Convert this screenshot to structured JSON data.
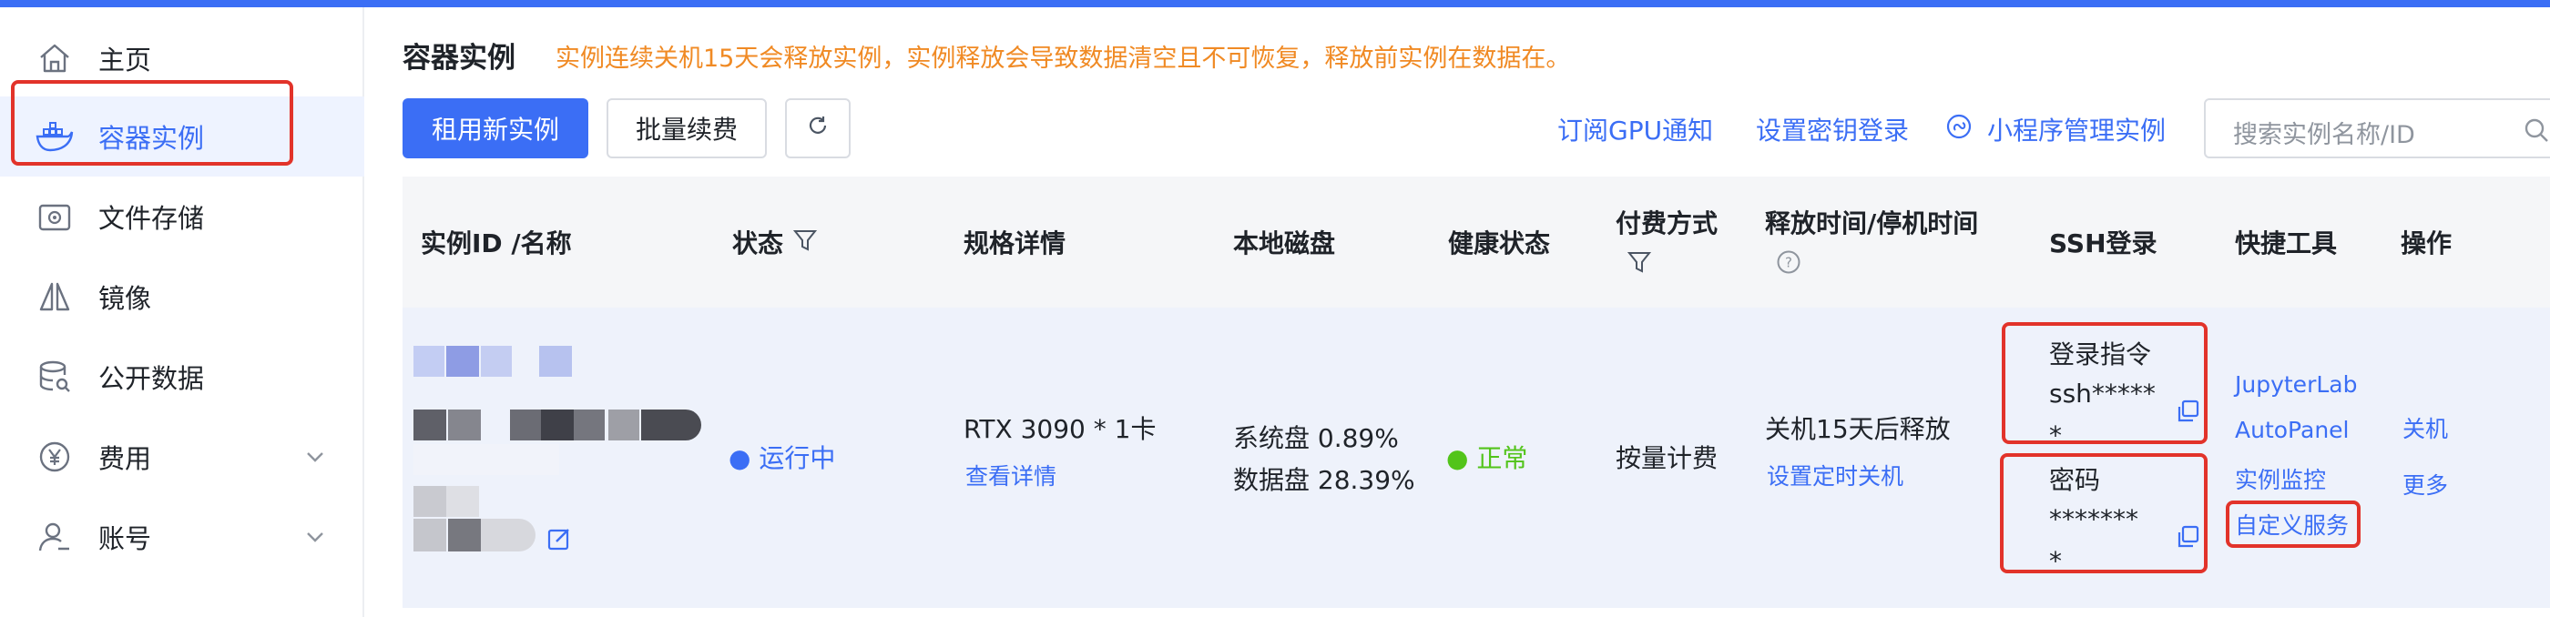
{
  "sidebar": {
    "items": [
      {
        "label": "主页",
        "icon": "home-icon"
      },
      {
        "label": "容器实例",
        "icon": "docker-icon"
      },
      {
        "label": "文件存储",
        "icon": "storage-icon"
      },
      {
        "label": "镜像",
        "icon": "image-icon"
      },
      {
        "label": "公开数据",
        "icon": "database-icon"
      },
      {
        "label": "费用",
        "icon": "yuan-icon"
      },
      {
        "label": "账号",
        "icon": "user-icon"
      }
    ]
  },
  "header": {
    "title": "容器实例",
    "notice": "实例连续关机15天会释放实例，实例释放会导致数据清空且不可恢复，释放前实例在数据在。"
  },
  "toolbar": {
    "rent_label": "租用新实例",
    "renew_label": "批量续费",
    "links": [
      "订阅GPU通知",
      "设置密钥登录",
      "小程序管理实例"
    ],
    "search_placeholder": "搜索实例名称/ID"
  },
  "table": {
    "columns": [
      "实例ID /名称",
      "状态",
      "规格详情",
      "本地磁盘",
      "健康状态",
      "付费方式",
      "释放时间/停机时间",
      "SSH登录",
      "快捷工具",
      "操作"
    ],
    "row": {
      "status": "● 运行中",
      "spec": "RTX 3090 * 1卡",
      "spec_link": "查看详情",
      "system_disk": "系统盘 0.89%",
      "data_disk": "数据盘 28.39%",
      "health": "● 正常",
      "billing": "按量计费",
      "release": "关机15天后释放",
      "release_link": "设置定时关机",
      "ssh_login_label": "登录指令",
      "ssh_login_value": "ssh*****",
      "ssh_login_value_2": "*",
      "ssh_password_label": "密码",
      "ssh_password_value": "*******",
      "ssh_password_value_2": "*",
      "tools": [
        "JupyterLab",
        "AutoPanel",
        "实例监控",
        "自定义服务"
      ],
      "actions": [
        "关机",
        "更多"
      ]
    }
  },
  "colors": {
    "accent": "#3b6ef5",
    "highlight": "#e2332a",
    "notice": "#f08a24",
    "success": "#52c41a"
  }
}
